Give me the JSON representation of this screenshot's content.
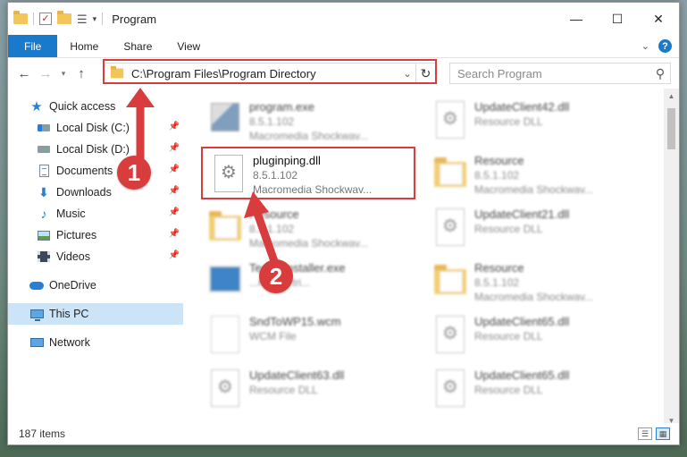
{
  "window": {
    "title": "Program",
    "controls": {
      "minimize": "—",
      "maximize": "☐",
      "close": "✕"
    }
  },
  "ribbon": {
    "tabs": [
      "File",
      "Home",
      "Share",
      "View"
    ],
    "help": "?"
  },
  "address": {
    "path": "C:\\Program Files\\Program Directory",
    "search_placeholder": "Search Program"
  },
  "nav": {
    "quick_access": "Quick access",
    "items": [
      {
        "label": "Local Disk (C:)"
      },
      {
        "label": "Local Disk (D:)"
      },
      {
        "label": "Documents"
      },
      {
        "label": "Downloads"
      },
      {
        "label": "Music"
      },
      {
        "label": "Pictures"
      },
      {
        "label": "Videos"
      }
    ],
    "onedrive": "OneDrive",
    "this_pc": "This PC",
    "network": "Network"
  },
  "files": [
    {
      "name": "program.exe",
      "version": "8.5.1.102",
      "desc": "Macromedia Shockwav...",
      "icon": "exe"
    },
    {
      "name": "UpdateClient42.dll",
      "version": "",
      "desc": "Resource DLL",
      "icon": "dll"
    },
    {
      "name": "pluginping.dll",
      "version": "8.5.1.102",
      "desc": "Macromedia Shockwav...",
      "icon": "dll"
    },
    {
      "name": "Resource",
      "version": "8.5.1.102",
      "desc": "Macromedia Shockwav...",
      "icon": "folder"
    },
    {
      "name": "Resource",
      "version": "8.5.1.102",
      "desc": "Macromedia Shockwav...",
      "icon": "folder"
    },
    {
      "name": "UpdateClient21.dll",
      "version": "",
      "desc": "Resource DLL",
      "icon": "dll"
    },
    {
      "name": "TeamsInstaller.exe",
      "version": "",
      "desc": "...reader tri...",
      "icon": "installer"
    },
    {
      "name": "Resource",
      "version": "8.5.1.102",
      "desc": "Macromedia Shockwav...",
      "icon": "folder"
    },
    {
      "name": "SndToWP15.wcm",
      "version": "",
      "desc": "WCM File",
      "icon": "blank"
    },
    {
      "name": "UpdateClient65.dll",
      "version": "",
      "desc": "Resource DLL",
      "icon": "dll"
    },
    {
      "name": "UpdateClient63.dll",
      "version": "",
      "desc": "Resource DLL",
      "icon": "dll"
    },
    {
      "name": "UpdateClient65.dll",
      "version": "",
      "desc": "Resource DLL",
      "icon": "dll"
    }
  ],
  "status": {
    "count": "187 items"
  },
  "annotations": {
    "step1": "1",
    "step2": "2",
    "color": "#d93c3c"
  }
}
